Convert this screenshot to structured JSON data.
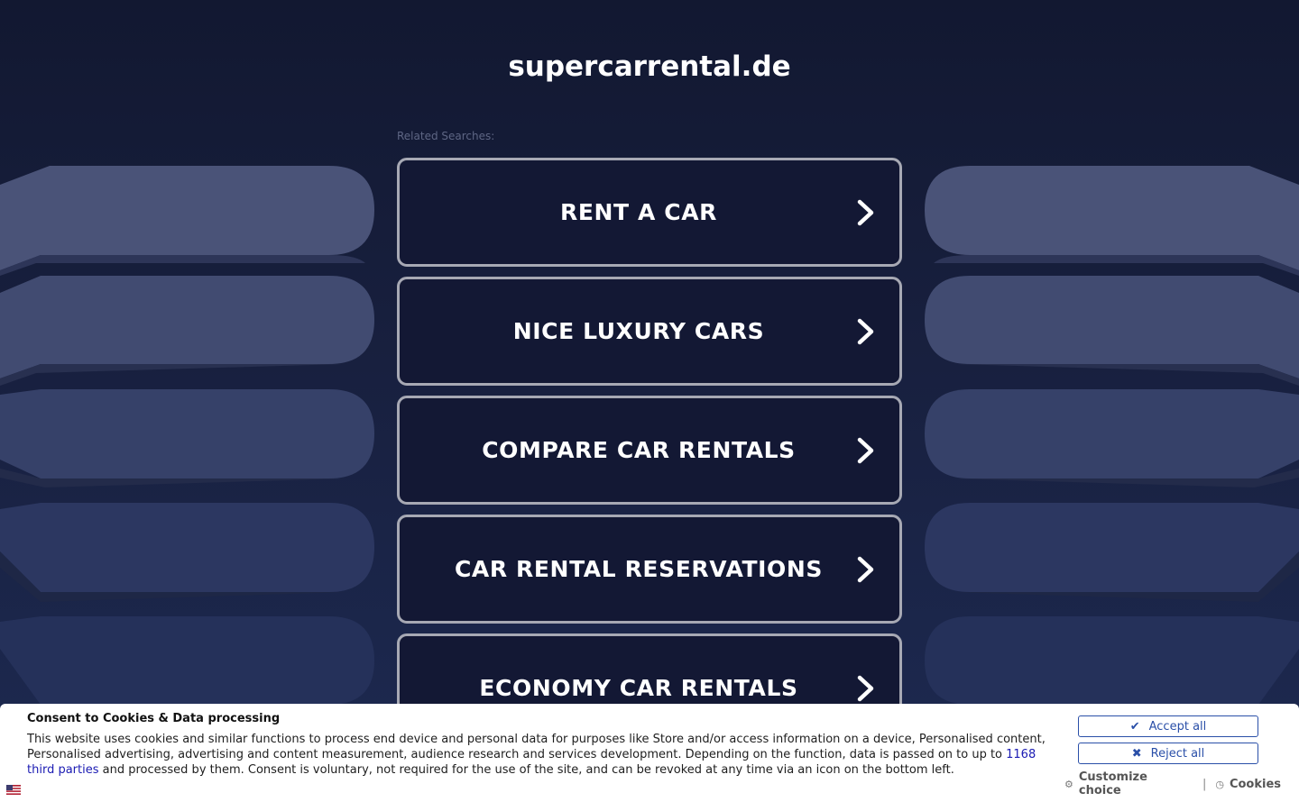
{
  "site": {
    "title": "supercarrental.de"
  },
  "related": {
    "label": "Related Searches:",
    "items": [
      {
        "label": "RENT A CAR"
      },
      {
        "label": "NICE LUXURY CARS"
      },
      {
        "label": "COMPARE CAR RENTALS"
      },
      {
        "label": "CAR RENTAL RESERVATIONS"
      },
      {
        "label": "ECONOMY CAR RENTALS"
      }
    ]
  },
  "consent": {
    "title": "Consent to Cookies & Data processing",
    "text_before": "This website uses cookies and similar functions to process end device and personal data for purposes like Store and/or access information on a device, Personalised content, Personalised advertising, advertising and content measurement, audience research and services development. Depending on the function, data is passed on to up to ",
    "third_parties_link": "1168 third parties",
    "text_after": " and processed by them. Consent is voluntary, not required for the use of the site, and can be revoked at any time via an icon on the bottom left.",
    "accept_label": "Accept all",
    "reject_label": "Reject all",
    "customize_label": "Customize choice",
    "separator": "|",
    "cookies_label": "Cookies",
    "accept_icon": "check-icon",
    "reject_icon": "x-icon",
    "customize_icon": "gear-icon",
    "cookies_icon": "clock-icon",
    "language_icon": "flag-icon"
  },
  "colors": {
    "background": "#151b35",
    "button_border": "#a7a9b4",
    "accent": "#2a4fa8",
    "link": "#1b1bb3"
  }
}
